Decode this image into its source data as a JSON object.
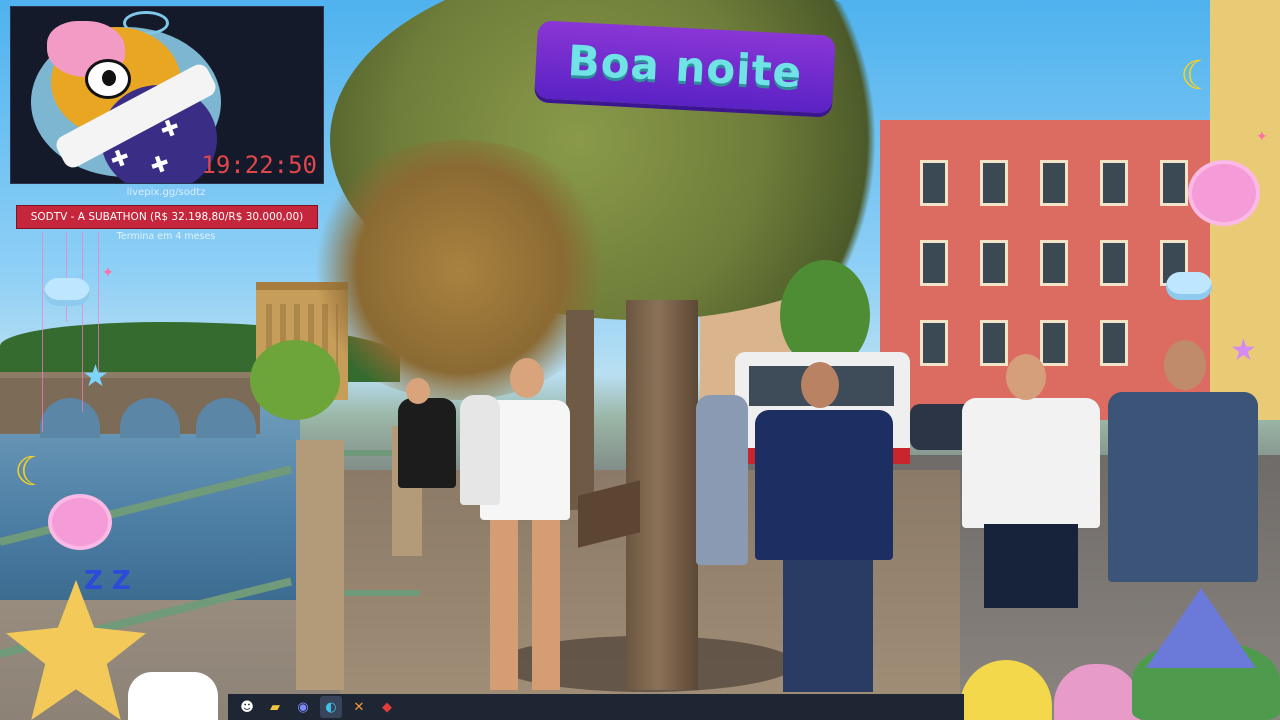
{
  "overlay": {
    "timer": "19:22:50",
    "stream_url": "livepix.gg/sodtz",
    "goal_text": "SODTV - A SUBATHON (R$ 32.198,80/R$ 30.000,00)",
    "goal_subtext": "Termina em 4 meses",
    "banner_text": "Boa noite",
    "sleep_text": "Z Z"
  },
  "taskbar": {
    "icons": [
      {
        "name": "emoji-app-icon",
        "glyph": "☻"
      },
      {
        "name": "file-explorer-icon",
        "glyph": "▰"
      },
      {
        "name": "discord-icon",
        "glyph": "◉"
      },
      {
        "name": "edge-browser-icon",
        "glyph": "◐"
      },
      {
        "name": "tools-app-icon",
        "glyph": "✕"
      },
      {
        "name": "red-app-icon",
        "glyph": "◆"
      }
    ]
  },
  "colors": {
    "goal_bar": "#c5263b",
    "timer": "#e0474c",
    "banner_bg": "#6b2bd0",
    "banner_text": "#6fe3e5"
  }
}
